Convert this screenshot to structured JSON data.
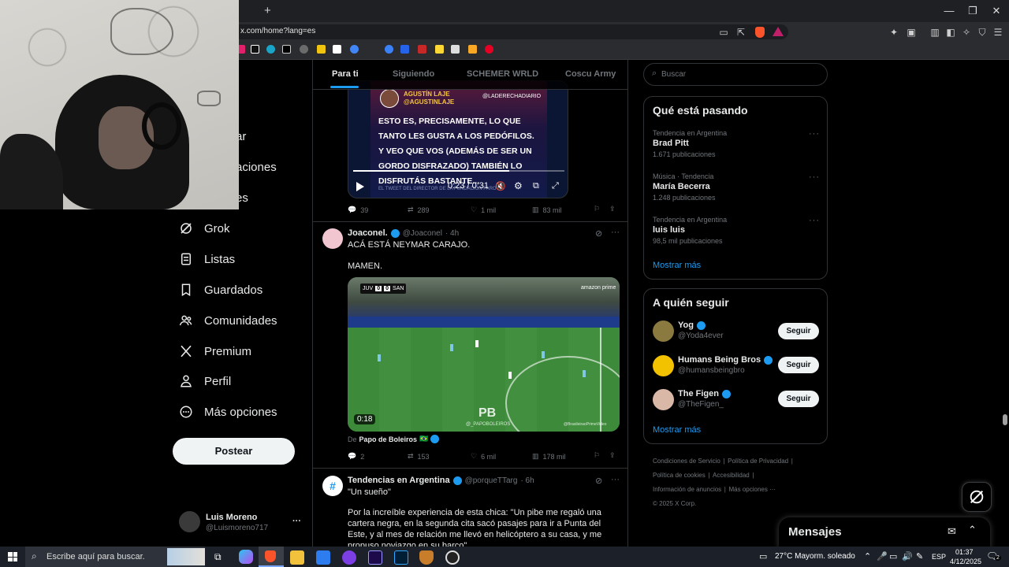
{
  "browser": {
    "url": "x.com/home?lang=es",
    "new_tab_label": "+"
  },
  "nav": {
    "items": [
      {
        "label": "ar"
      },
      {
        "label": "aciones"
      },
      {
        "label": "es"
      },
      {
        "label": "Grok"
      },
      {
        "label": "Listas"
      },
      {
        "label": "Guardados"
      },
      {
        "label": "Comunidades"
      },
      {
        "label": "Premium"
      },
      {
        "label": "Perfil"
      },
      {
        "label": "Más opciones"
      }
    ],
    "post_button": "Postear",
    "account": {
      "name": "Luis Moreno",
      "handle": "@Luismoreno717",
      "more": "···"
    }
  },
  "feed": {
    "tabs": [
      "Para ti",
      "Siguiendo",
      "SCHEMER WRLD",
      "Coscu Army"
    ],
    "post1": {
      "card_name": "AGUSTÍN LAJE",
      "card_handle": "@AGUSTINLAJE",
      "card_source": "@LADERECHADIARIO",
      "card_text": "ESTO ES, PRECISAMENTE, LO QUE TANTO LES GUSTA A LOS PEDÓFILOS. Y VEO QUE VOS (ADEMÁS DE SER UN GORDO DISFRAZADO) TAMBIÉN LO DISFRUTÁS BASTANTE...",
      "card_footer": "EL TWEET DEL DIRECTOR DE LA FUNDACIÓN FARO",
      "video_time": "0:23 / 0:31",
      "progress": 0.74,
      "replies": "39",
      "reposts": "289",
      "likes": "1 mil",
      "views": "83 mil"
    },
    "post2": {
      "name": "Joaconel.",
      "handle": "@Joaconel",
      "time": "· 4h",
      "text1": "ACÁ ESTÁ NEYMAR CARAJO.",
      "text2": "MAMEN.",
      "video_duration": "0:18",
      "score_left": "0",
      "score_right": "0",
      "team_left": "JUV",
      "team_right": "SAN",
      "broadcaster": "amazon prime",
      "watermark": "PB",
      "watermark_sub": "@_PAPOBOLEIROS",
      "watermark_right": "@BrasileiraoPrimeVideo",
      "source_prefix": "De",
      "source_name": "Papo de Boleiros",
      "source_flag": "🇧🇷",
      "replies": "2",
      "reposts": "153",
      "likes": "6 mil",
      "views": "178 mil"
    },
    "post3": {
      "name": "Tendencias en Argentina",
      "handle": "@porqueTTarg",
      "time": "· 6h",
      "text1": "\"Un sueño\"",
      "text2": "Por la increíble experiencia de esta chica: \"Un pibe me regaló una cartera negra, en la segunda cita sacó pasajes para ir a Punta del Este, y al mes de relación me llevó en helicóptero a su casa, y me propuso noviazgo en su barco\""
    }
  },
  "right": {
    "search_placeholder": "Buscar",
    "trends_title": "Qué está pasando",
    "trends": [
      {
        "meta": "Tendencia en Argentina",
        "name": "Brad Pitt",
        "count": "1.671 publicaciones"
      },
      {
        "meta": "Música · Tendencia",
        "name": "María Becerra",
        "count": "1.248 publicaciones"
      },
      {
        "meta": "Tendencia en Argentina",
        "name": "luis luis",
        "count": "98,5 mil publicaciones"
      }
    ],
    "show_more": "Mostrar más",
    "who_title": "A quién seguir",
    "who": [
      {
        "name": "Yog",
        "handle": "@Yoda4ever",
        "button": "Seguir"
      },
      {
        "name": "Humans Being Bros",
        "handle": "@humansbeingbro",
        "button": "Seguir"
      },
      {
        "name": "The Figen",
        "handle": "@TheFigen_",
        "button": "Seguir"
      }
    ],
    "who_more": "Mostrar más",
    "footer": {
      "l1": "Condiciones de Servicio",
      "l2": "Política de Privacidad",
      "l3": "Política de cookies",
      "l4": "Accesibilidad",
      "l5": "Información de anuncios",
      "l6": "Más opciones ···",
      "copy": "© 2025 X Corp."
    }
  },
  "messages": {
    "title": "Mensajes"
  },
  "taskbar": {
    "search_placeholder": "Escribe aquí para buscar.",
    "weather": "27°C  Mayorm. soleado",
    "lang": "ESP",
    "time": "01:37",
    "date": "4/12/2025",
    "notif_count": "2"
  },
  "colors": {
    "accent": "#1d9bf0",
    "bg": "#000000",
    "border": "#2f3336",
    "muted": "#71767b"
  }
}
